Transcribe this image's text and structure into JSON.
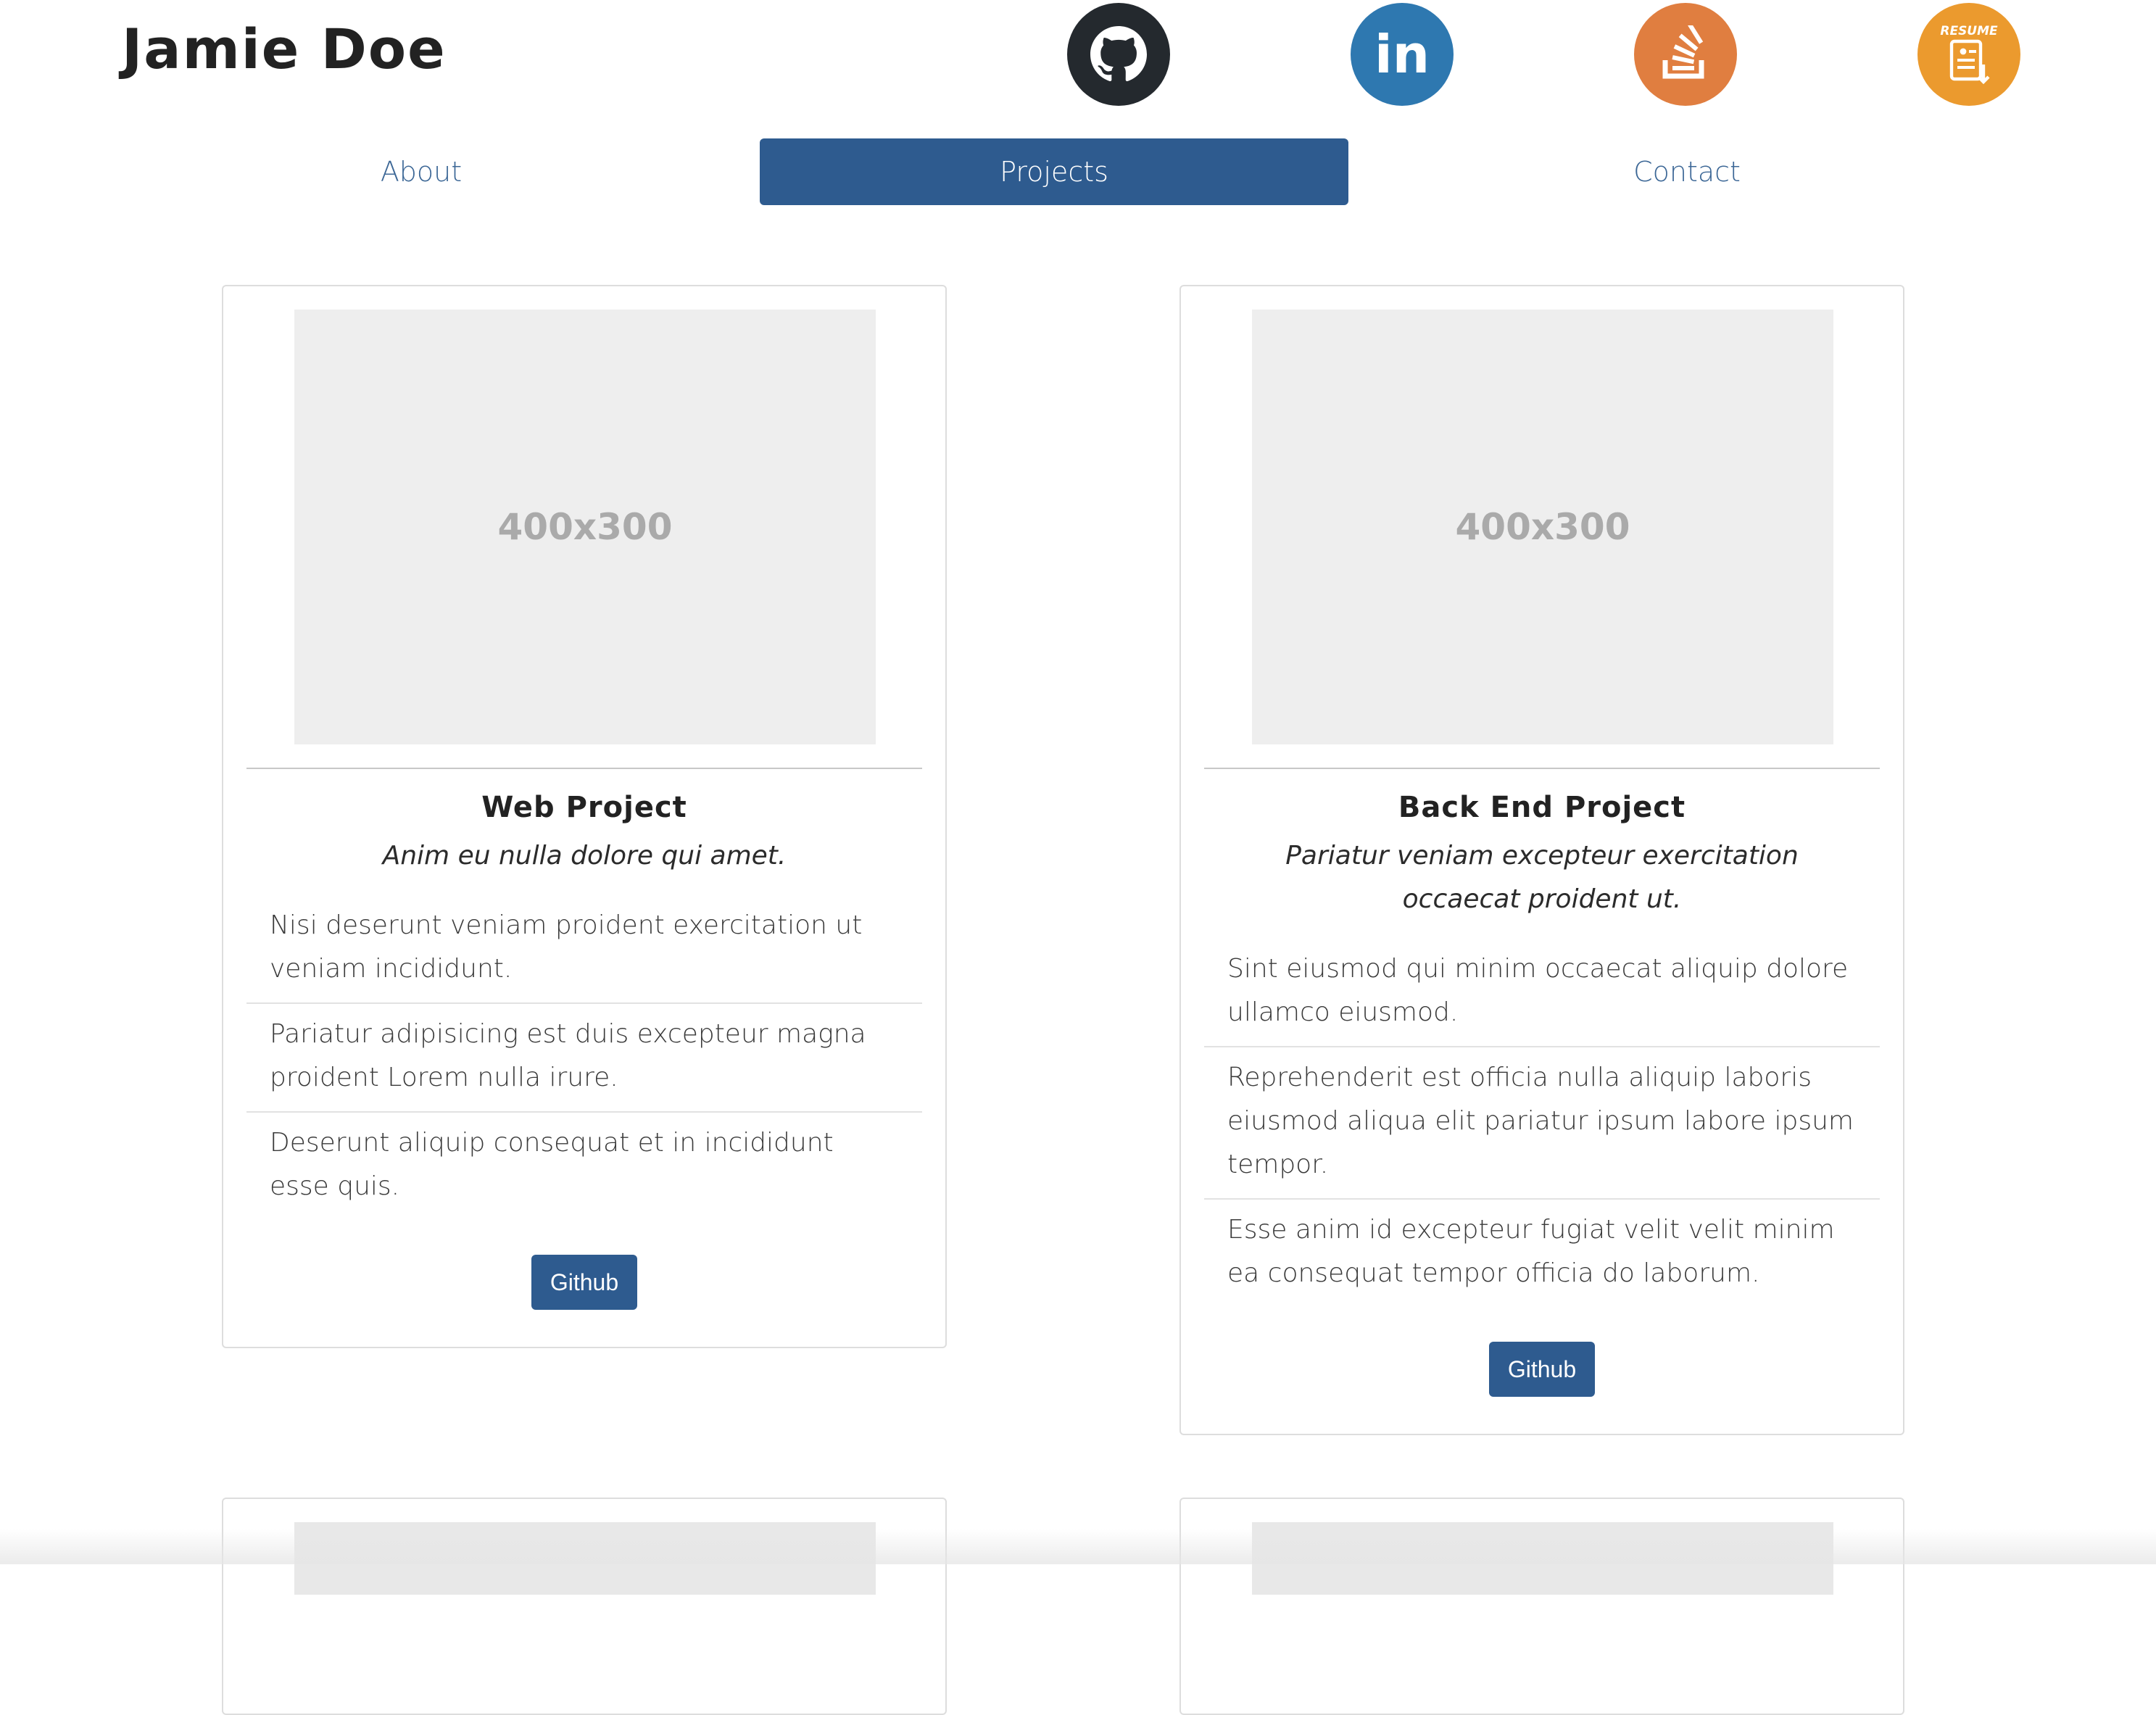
{
  "header": {
    "name": "Jamie Doe",
    "social": [
      {
        "icon": "github-icon",
        "color": "#24292e"
      },
      {
        "icon": "linkedin-icon",
        "color": "#2e78b0",
        "text": "in"
      },
      {
        "icon": "stackoverflow-icon",
        "color": "#e07e40"
      },
      {
        "icon": "resume-icon",
        "color": "#eb9a2e",
        "text": "RESUME"
      }
    ]
  },
  "nav": {
    "about": "About",
    "projects": "Projects",
    "contact": "Contact",
    "active": "Projects"
  },
  "projects": [
    {
      "image_label": "400x300",
      "title": "Web Project",
      "subtitle": "Anim eu nulla dolore qui amet.",
      "items": [
        "Nisi deserunt veniam proident exercitation ut veniam incididunt.",
        "Pariatur adipisicing est duis excepteur magna proident Lorem nulla irure.",
        "Deserunt aliquip consequat et in incididunt esse quis."
      ],
      "button": "Github"
    },
    {
      "image_label": "400x300",
      "title": "Back End Project",
      "subtitle": "Pariatur veniam excepteur exercitation occaecat proident ut.",
      "items": [
        "Sint eiusmod qui minim occaecat aliquip dolore ullamco eiusmod.",
        "Reprehenderit est officia nulla aliquip laboris eiusmod aliqua elit pariatur ipsum labore ipsum tempor.",
        "Esse anim id excepteur fugiat velit velit minim ea consequat tempor officia do laborum."
      ],
      "button": "Github"
    }
  ],
  "colors": {
    "primary": "#2e5b8f",
    "nav_link": "#3c6796",
    "placeholder_bg": "#eeeeee"
  }
}
